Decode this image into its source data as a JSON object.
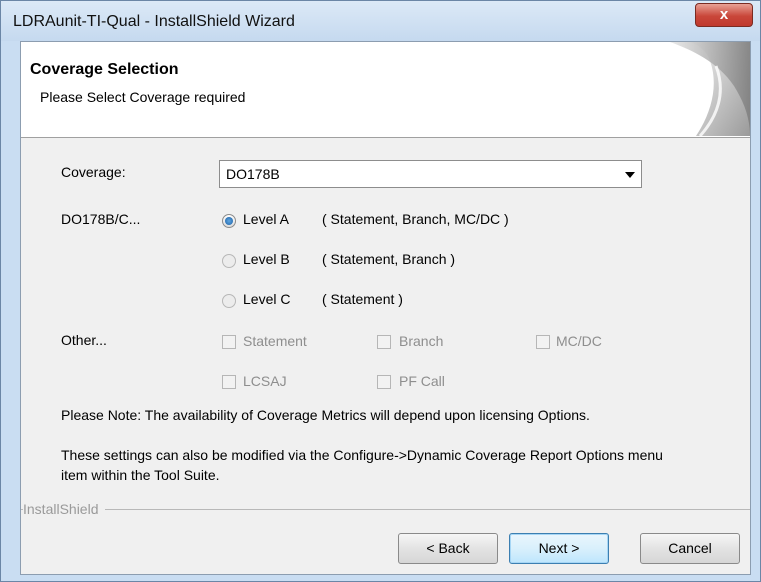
{
  "window": {
    "title": "LDRAunit-TI-Qual - InstallShield Wizard",
    "close_label": "x"
  },
  "header": {
    "title": "Coverage Selection",
    "subtitle": "Please Select Coverage required"
  },
  "coverage": {
    "label": "Coverage:",
    "selected": "DO178B"
  },
  "levels": {
    "group_label": "DO178B/C...",
    "items": [
      {
        "label": "Level A",
        "desc": "( Statement, Branch, MC/DC )",
        "selected": true
      },
      {
        "label": "Level B",
        "desc": "( Statement, Branch )",
        "selected": false
      },
      {
        "label": "Level C",
        "desc": "( Statement )",
        "selected": false
      }
    ]
  },
  "other": {
    "label": "Other...",
    "checkboxes": [
      "Statement",
      "Branch",
      "MC/DC",
      "LCSAJ",
      "PF Call"
    ]
  },
  "notes": {
    "note1": "Please Note: The availability of Coverage Metrics will depend upon licensing Options.",
    "note2_line1": "These settings can also be modified via the Configure->Dynamic Coverage Report Options menu",
    "note2_line2": "item within the Tool Suite."
  },
  "footer": {
    "brand": "InstallShield"
  },
  "buttons": {
    "back": "< Back",
    "next": "Next >",
    "cancel": "Cancel"
  }
}
